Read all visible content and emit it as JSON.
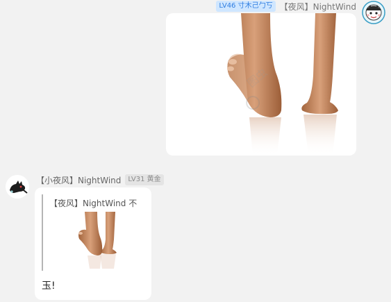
{
  "message_1": {
    "badge": "LV46 寸木己勹丂",
    "sender": "【夜风】NightWind",
    "avatar_icon": "cartoon-face-avatar",
    "image_icon": "foot-photo"
  },
  "message_2": {
    "sender": "【小夜风】NightWind",
    "badge": "LV31 黄金",
    "avatar_icon": "black-cat-avatar",
    "quote": {
      "sender": "【夜风】NightWind 不",
      "thumbnail_icon": "foot-photo-thumbnail"
    },
    "text": "玉!"
  },
  "colors": {
    "background": "#f2f2f2",
    "badge_blue_bg": "#cfe6ff",
    "badge_blue_text": "#2f7de0",
    "badge_gray_bg": "#e4e4e4",
    "bubble": "#ffffff"
  }
}
